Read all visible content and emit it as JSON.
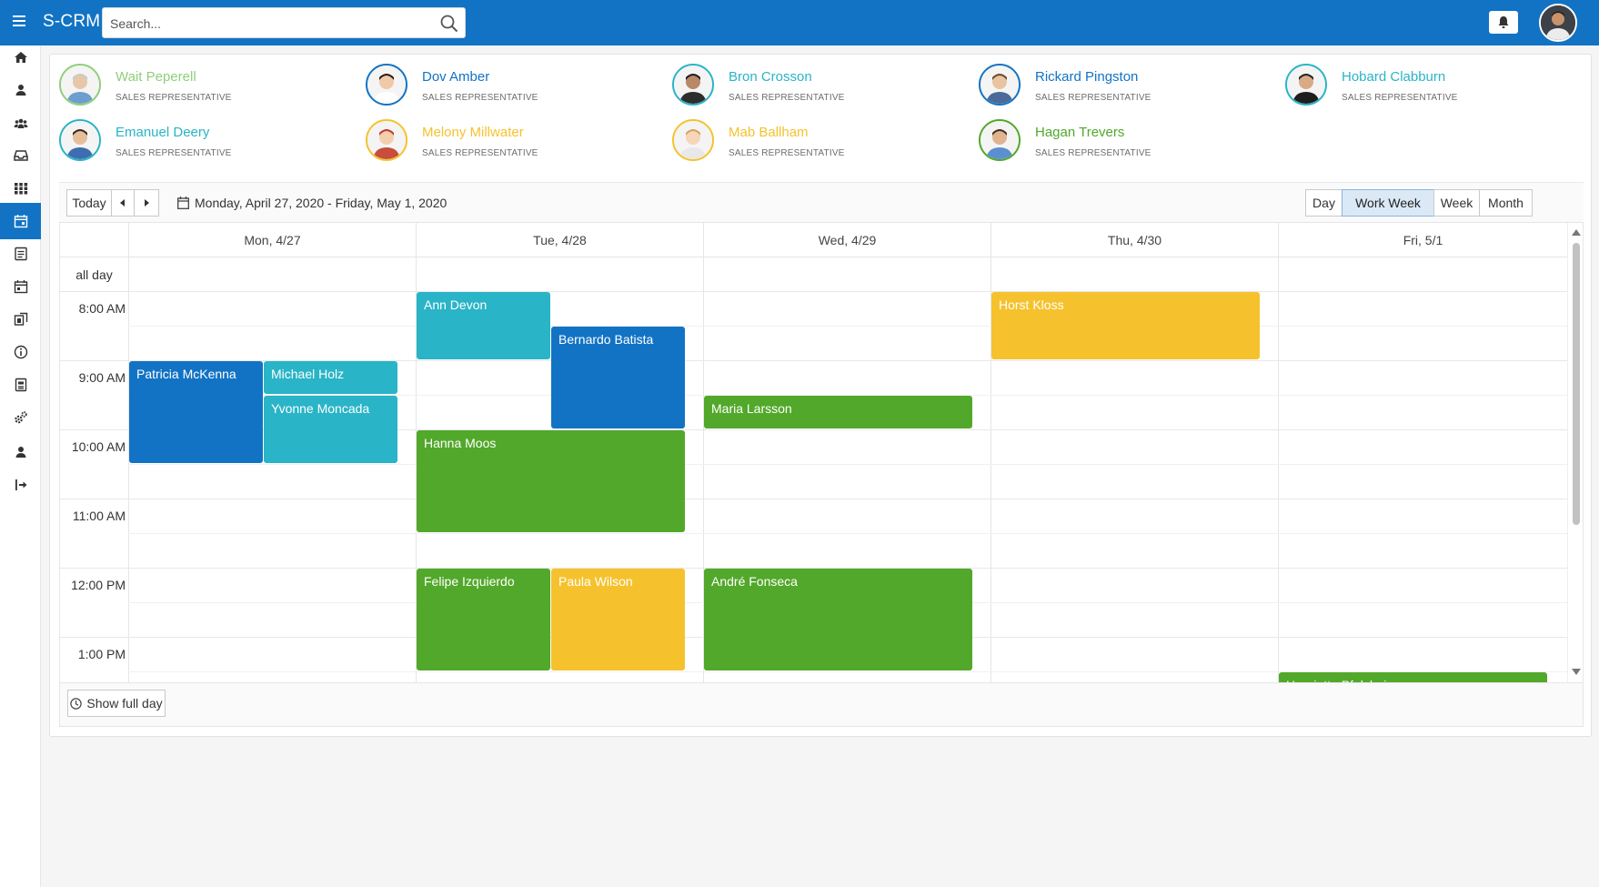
{
  "app": {
    "title": "S-CRM"
  },
  "search": {
    "placeholder": "Search..."
  },
  "sidebar": {
    "items": [
      {
        "icon": "home-icon"
      },
      {
        "icon": "user-icon"
      },
      {
        "icon": "users-icon"
      },
      {
        "icon": "inbox-icon"
      },
      {
        "icon": "apps-grid-icon"
      },
      {
        "icon": "calendar-icon",
        "active": true
      },
      {
        "icon": "list-icon"
      },
      {
        "icon": "calendar-event-icon"
      },
      {
        "icon": "board-icon"
      },
      {
        "icon": "info-icon"
      },
      {
        "icon": "document-icon"
      },
      {
        "icon": "gears-icon"
      },
      {
        "icon": "user-icon"
      },
      {
        "icon": "logout-icon"
      }
    ]
  },
  "employees": [
    {
      "name": "Wait Peperell",
      "role": "Sales Representative",
      "color": "#8fcf7a"
    },
    {
      "name": "Dov Amber",
      "role": "Sales Representative",
      "color": "#1273c4"
    },
    {
      "name": "Bron Crosson",
      "role": "Sales Representative",
      "color": "#2ab4c7"
    },
    {
      "name": "Rickard Pingston",
      "role": "Sales Representative",
      "color": "#1273c4"
    },
    {
      "name": "Hobard Clabburn",
      "role": "Sales Representative",
      "color": "#2ab4c7"
    },
    {
      "name": "Emanuel Deery",
      "role": "Sales Representative",
      "color": "#2ab4c7"
    },
    {
      "name": "Melony Millwater",
      "role": "Sales Representative",
      "color": "#f5c22e"
    },
    {
      "name": "Mab Ballham",
      "role": "Sales Representative",
      "color": "#f5c22e"
    },
    {
      "name": "Hagan Trevers",
      "role": "Sales Representative",
      "color": "#52a82a"
    }
  ],
  "toolbar": {
    "today_label": "Today",
    "date_range": "Monday, April 27, 2020 - Friday, May 1, 2020",
    "views": [
      "Day",
      "Work Week",
      "Week",
      "Month"
    ],
    "selected_view": "Work Week"
  },
  "scheduler": {
    "days": [
      "Mon, 4/27",
      "Tue, 4/28",
      "Wed, 4/29",
      "Thu, 4/30",
      "Fri, 5/1"
    ],
    "all_day_label": "all day",
    "times": [
      "8:00 AM",
      "9:00 AM",
      "10:00 AM",
      "11:00 AM",
      "12:00 PM",
      "1:00 PM"
    ],
    "events": [
      {
        "title": "Ann Devon",
        "day": 1,
        "start": 8.0,
        "end": 9.0,
        "lane": 0,
        "lanes": 2,
        "color": "#2ab4c7"
      },
      {
        "title": "Bernardo Batista",
        "day": 1,
        "start": 8.5,
        "end": 10.0,
        "lane": 1,
        "lanes": 2,
        "color": "#1273c4"
      },
      {
        "title": "Horst Kloss",
        "day": 3,
        "start": 8.0,
        "end": 9.0,
        "lane": 0,
        "lanes": 1,
        "color": "#f5c22e"
      },
      {
        "title": "Patricia McKenna",
        "day": 0,
        "start": 9.0,
        "end": 10.5,
        "lane": 0,
        "lanes": 2,
        "color": "#1273c4"
      },
      {
        "title": "Michael Holz",
        "day": 0,
        "start": 9.0,
        "end": 9.5,
        "lane": 1,
        "lanes": 2,
        "color": "#2ab4c7"
      },
      {
        "title": "Yvonne Moncada",
        "day": 0,
        "start": 9.5,
        "end": 10.5,
        "lane": 1,
        "lanes": 2,
        "color": "#2ab4c7"
      },
      {
        "title": "Maria Larsson",
        "day": 2,
        "start": 9.5,
        "end": 10.0,
        "lane": 0,
        "lanes": 1,
        "color": "#52a82a"
      },
      {
        "title": "Hanna Moos",
        "day": 1,
        "start": 10.0,
        "end": 11.5,
        "lane": 0,
        "lanes": 1,
        "color": "#52a82a"
      },
      {
        "title": "Felipe Izquierdo",
        "day": 1,
        "start": 12.0,
        "end": 13.5,
        "lane": 0,
        "lanes": 2,
        "color": "#52a82a"
      },
      {
        "title": "Paula Wilson",
        "day": 1,
        "start": 12.0,
        "end": 13.5,
        "lane": 1,
        "lanes": 2,
        "color": "#f5c22e"
      },
      {
        "title": "André Fonseca",
        "day": 2,
        "start": 12.0,
        "end": 13.5,
        "lane": 0,
        "lanes": 1,
        "color": "#52a82a"
      },
      {
        "title": "Henriette Pfalzheim",
        "day": 4,
        "start": 13.5,
        "end": 14.5,
        "lane": 0,
        "lanes": 1,
        "color": "#52a82a"
      }
    ]
  },
  "footer": {
    "show_full_day_label": "Show full day"
  }
}
